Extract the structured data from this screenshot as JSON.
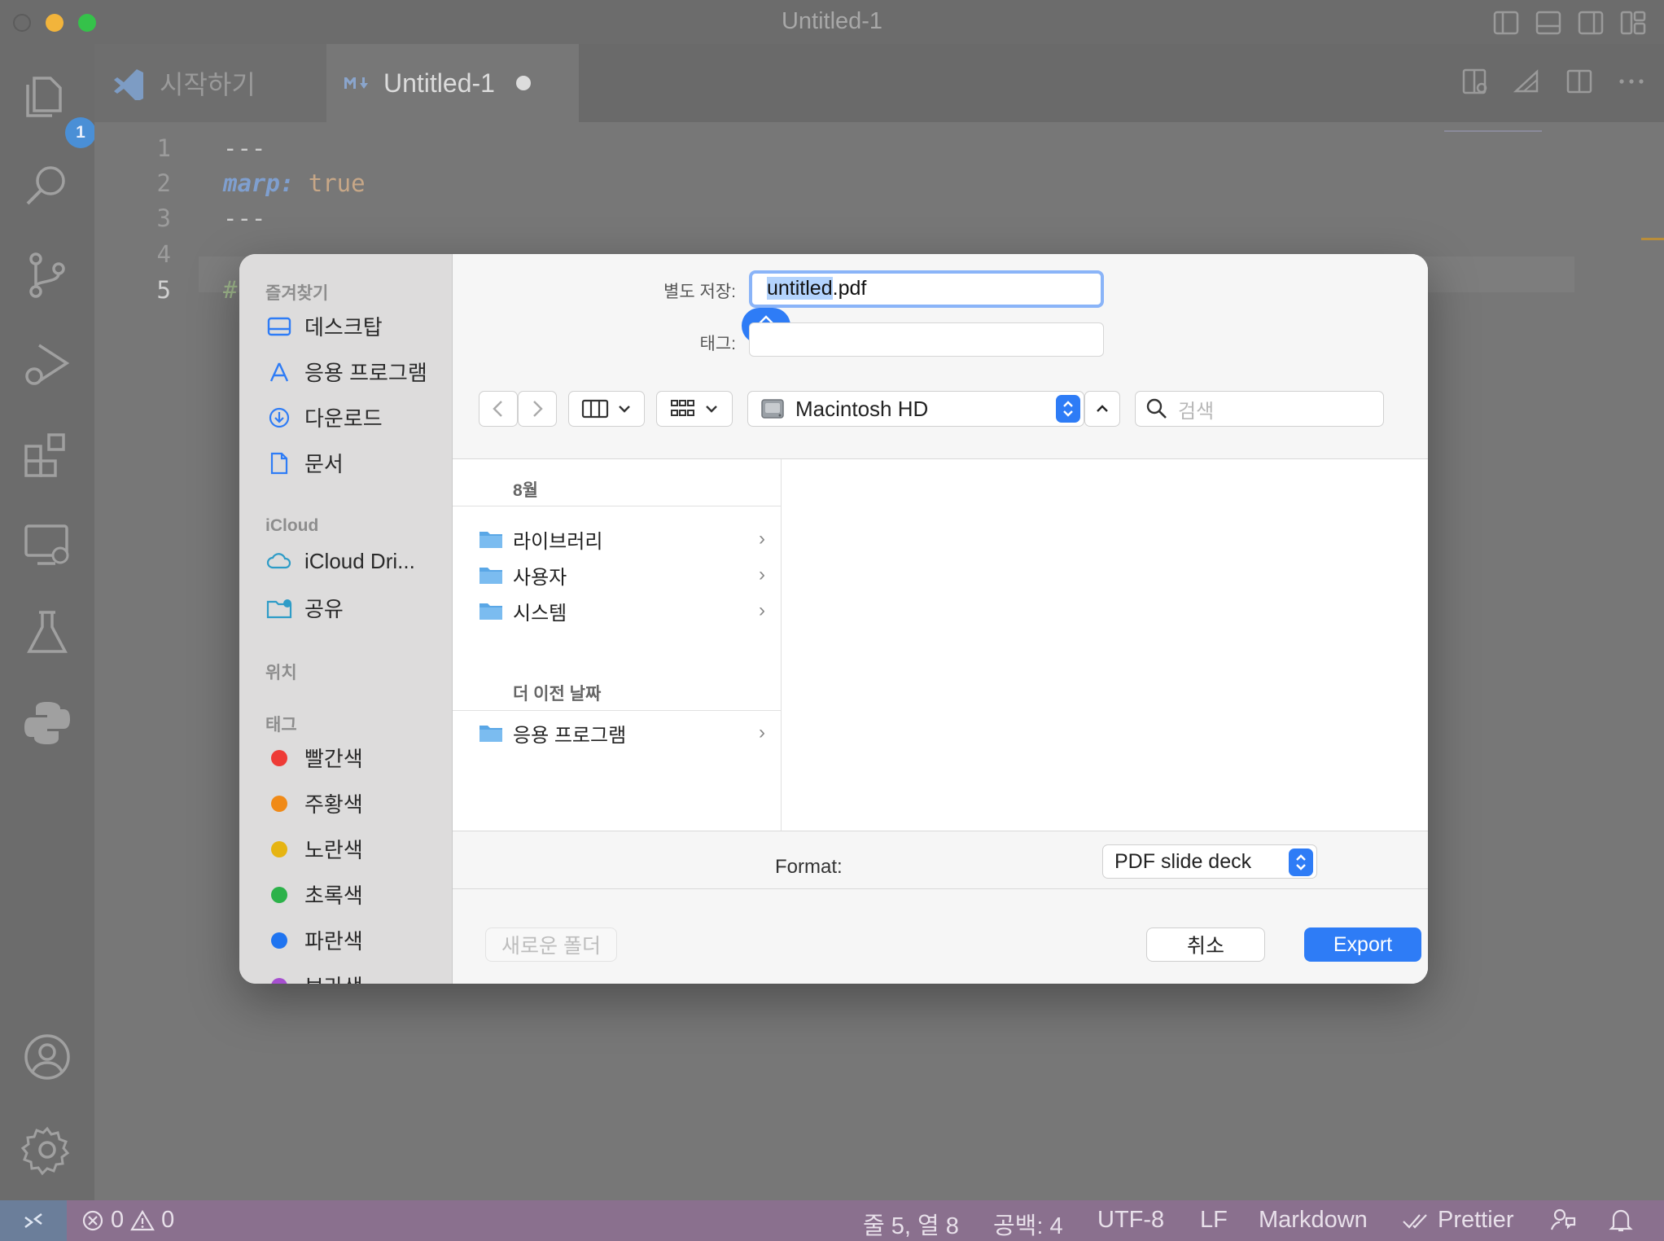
{
  "window": {
    "title": "Untitled-1"
  },
  "activity": {
    "explorer_badge": "1"
  },
  "tabs": [
    {
      "label": "시작하기"
    },
    {
      "label": "Untitled-1",
      "modified": true
    }
  ],
  "editor": {
    "lines": [
      {
        "num": "1",
        "text": "---"
      },
      {
        "num": "2",
        "key": "marp",
        "sep": ": ",
        "value": "true"
      },
      {
        "num": "3",
        "text": "---"
      },
      {
        "num": "4",
        "text": ""
      },
      {
        "num": "5",
        "text": "#"
      }
    ]
  },
  "dialog": {
    "save_as_label": "별도 저장:",
    "filename_selected": "untitled",
    "filename_ext": ".pdf",
    "tags_label": "태그:",
    "location": "Macintosh HD",
    "search_placeholder": "검색",
    "sidebar": {
      "favorites_header": "즐겨찾기",
      "favorites": [
        "데스크탑",
        "응용 프로그램",
        "다운로드",
        "문서"
      ],
      "icloud_header": "iCloud",
      "icloud": [
        "iCloud Dri...",
        "공유"
      ],
      "locations_header": "위치",
      "tags_header": "태그",
      "tags": [
        {
          "label": "빨간색",
          "color": "#ee3b36"
        },
        {
          "label": "주황색",
          "color": "#f08a17"
        },
        {
          "label": "노란색",
          "color": "#e6b412"
        },
        {
          "label": "초록색",
          "color": "#2cb24a"
        },
        {
          "label": "파란색",
          "color": "#1f74f0"
        },
        {
          "label": "보라색",
          "color": "#a64fd0"
        }
      ]
    },
    "browser": {
      "group1": "8월",
      "items1": [
        "라이브러리",
        "사용자",
        "시스템"
      ],
      "group2": "더 이전 날짜",
      "items2": [
        "응용 프로그램"
      ]
    },
    "format_label": "Format:",
    "format_value": "PDF slide deck",
    "new_folder_label": "새로운 폴더",
    "cancel_label": "취소",
    "export_label": "Export"
  },
  "status": {
    "errors": "0",
    "warnings": "0",
    "position": "줄 5, 열 8",
    "spaces": "공백: 4",
    "encoding": "UTF-8",
    "eol": "LF",
    "language": "Markdown",
    "formatter": "Prettier"
  }
}
